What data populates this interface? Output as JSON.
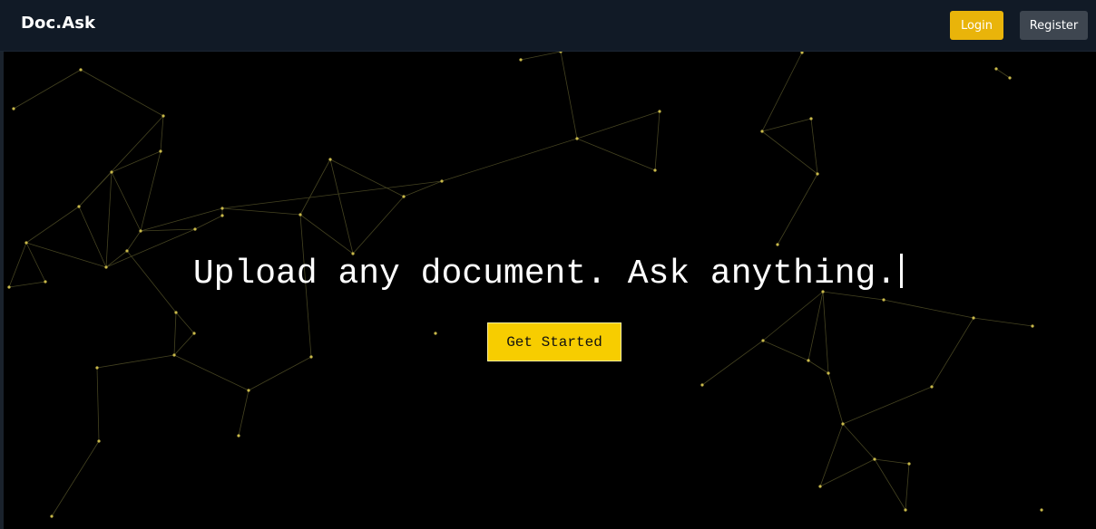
{
  "navbar": {
    "brand": "Doc.Ask",
    "login_label": "Login",
    "register_label": "Register"
  },
  "hero": {
    "headline": "Upload any document. Ask anything.",
    "cta_label": "Get Started"
  },
  "colors": {
    "accent": "#f7cd00",
    "login_button": "#e9b40a",
    "register_button": "#3e4650",
    "navbar": "#111a26",
    "network_node": "#c9b94a",
    "network_line": "#5c5a2c"
  },
  "background": {
    "style": "particle-network"
  }
}
